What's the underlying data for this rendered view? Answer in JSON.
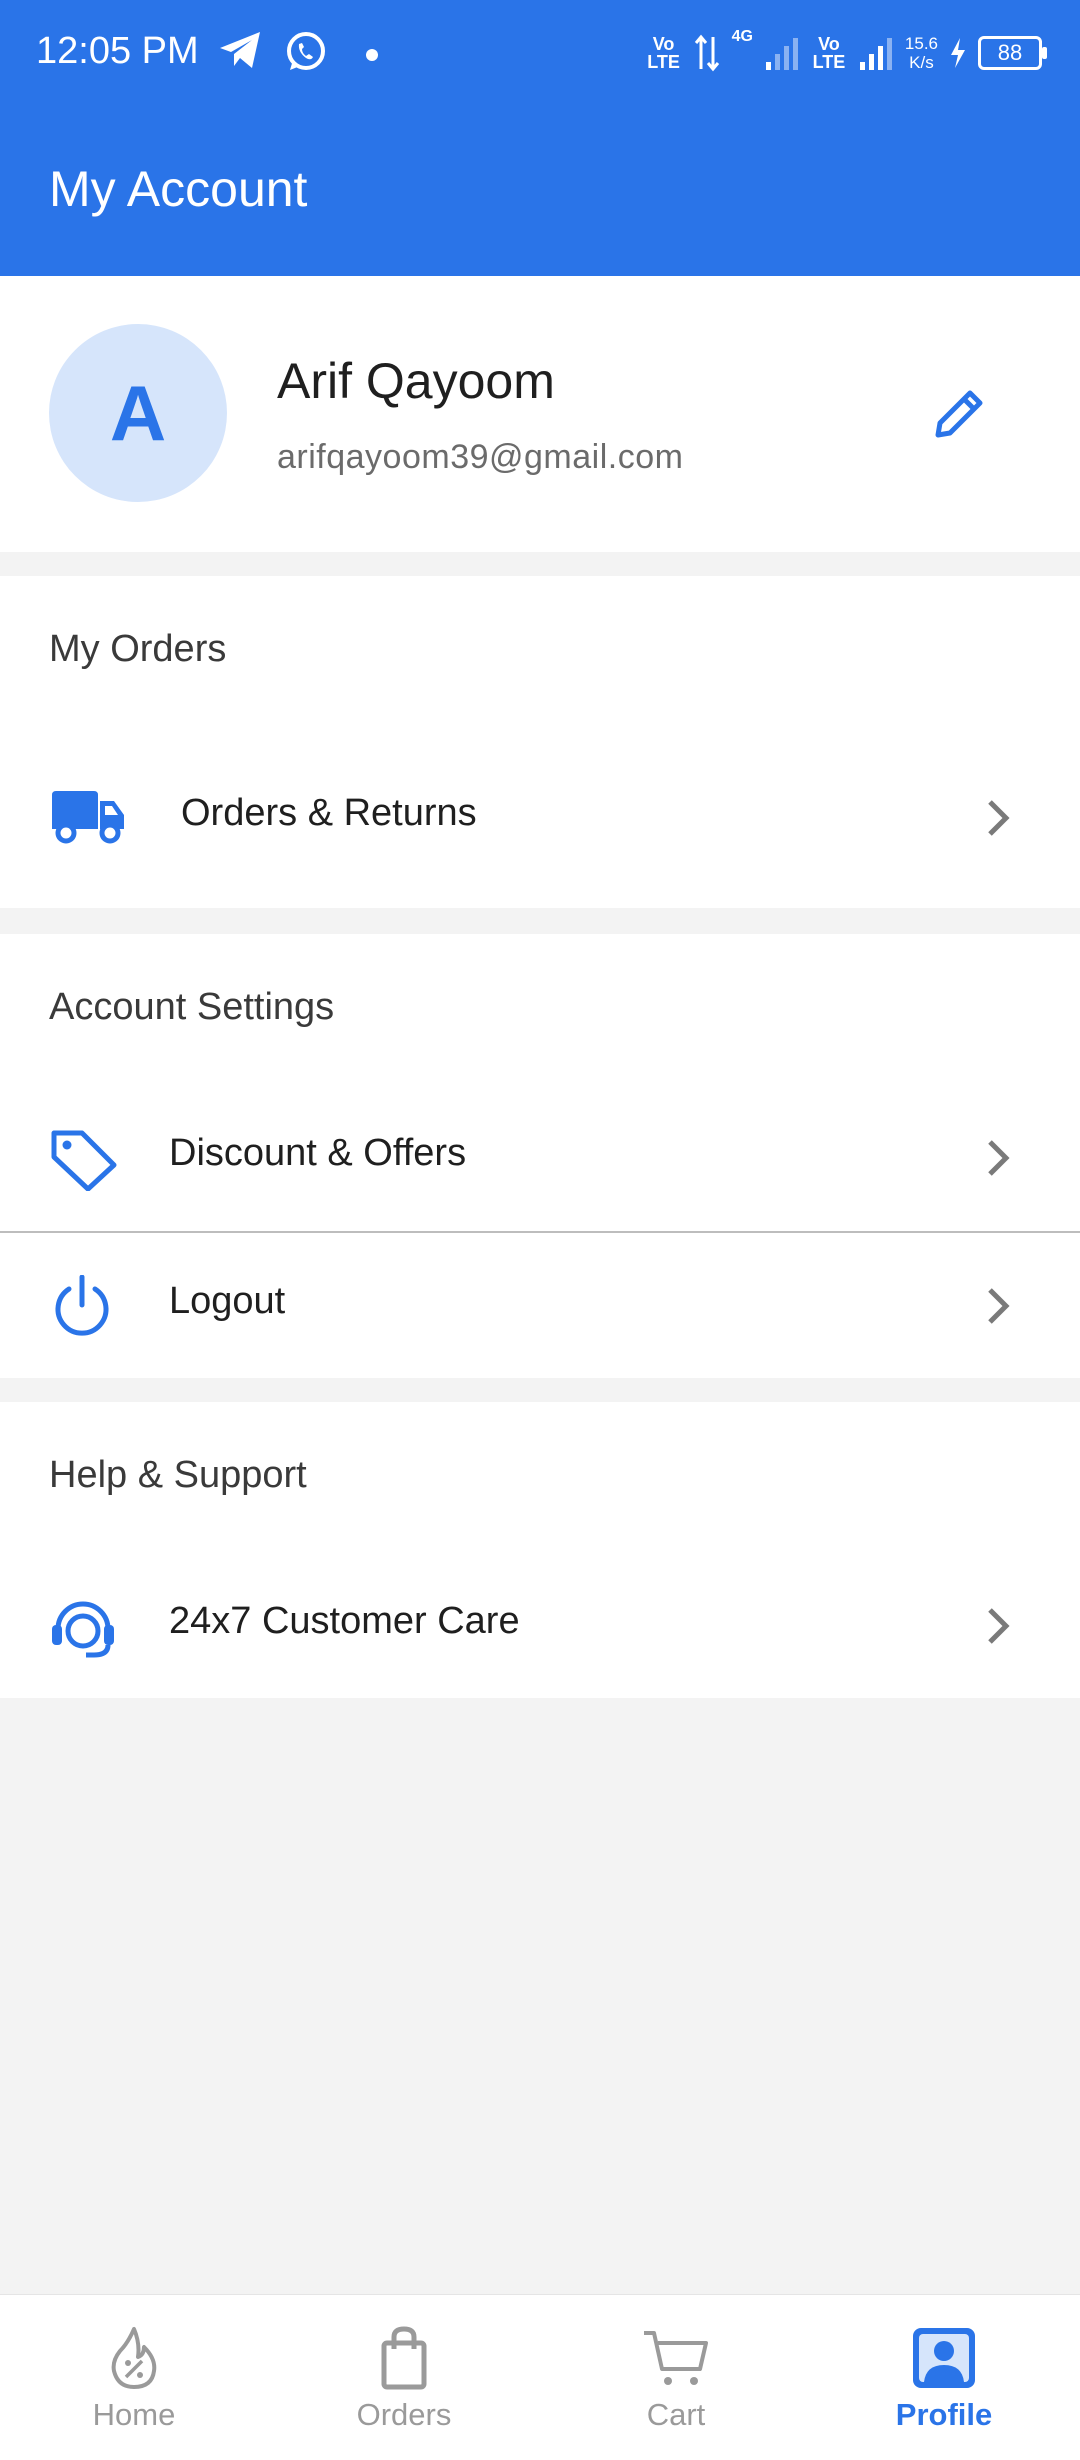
{
  "status_bar": {
    "time": "12:05 PM",
    "net_speed_value": "15.6",
    "net_speed_unit": "K/s",
    "battery": "88",
    "network_labels": [
      "Vo LTE",
      "4G",
      "Vo LTE"
    ]
  },
  "app_bar": {
    "title": "My Account"
  },
  "profile": {
    "avatar_initial": "A",
    "name": "Arif Qayoom",
    "email": "arifqayoom39@gmail.com"
  },
  "sections": {
    "orders": {
      "title": "My Orders",
      "items": [
        {
          "label": "Orders & Returns",
          "icon": "truck-icon"
        }
      ]
    },
    "account": {
      "title": "Account Settings",
      "items": [
        {
          "label": "Discount & Offers",
          "icon": "tag-icon"
        },
        {
          "label": "Logout",
          "icon": "power-icon"
        }
      ]
    },
    "help": {
      "title": "Help & Support",
      "items": [
        {
          "label": "24x7 Customer Care",
          "icon": "headset-icon"
        }
      ]
    }
  },
  "bottom_nav": [
    {
      "label": "Home",
      "icon": "home-discount-icon",
      "active": false
    },
    {
      "label": "Orders",
      "icon": "bag-icon",
      "active": false
    },
    {
      "label": "Cart",
      "icon": "cart-icon",
      "active": false
    },
    {
      "label": "Profile",
      "icon": "profile-icon",
      "active": true
    }
  ],
  "colors": {
    "primary": "#2a74e8",
    "avatar_bg": "#d6e5fb",
    "background": "#f3f3f3",
    "inactive": "#9a9a9a"
  }
}
